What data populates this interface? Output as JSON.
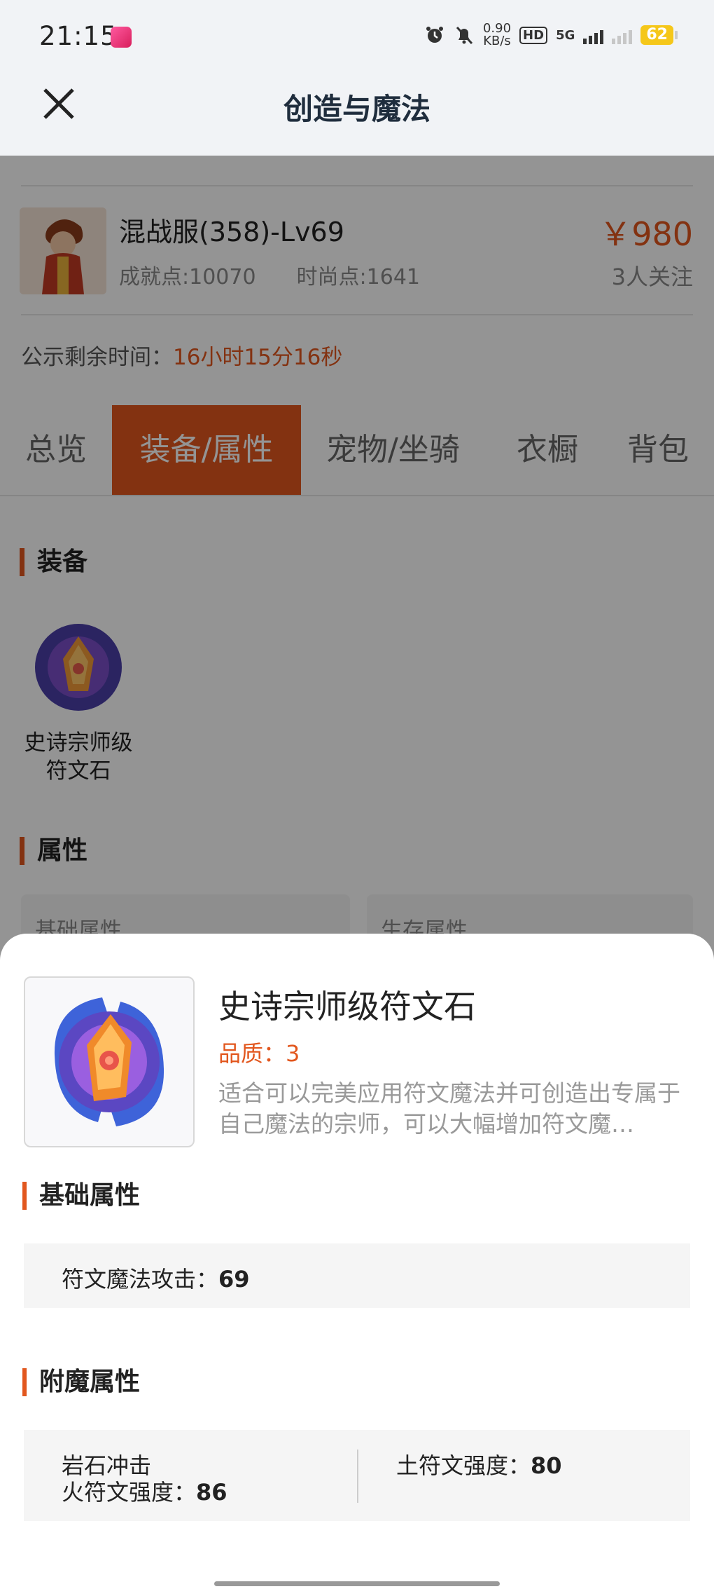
{
  "status_bar": {
    "time": "21:15",
    "net_speed_value": "0.90",
    "net_speed_unit": "KB/s",
    "hd_label": "HD",
    "network_label": "5G",
    "battery": "62"
  },
  "header": {
    "title": "创造与魔法"
  },
  "listing": {
    "name": "混战服(358)-Lv69",
    "achievement": "成就点:10070",
    "fashion": "时尚点:1641",
    "price": "￥980",
    "followers": "3人关注",
    "timer_label": "公示剩余时间：",
    "timer_value": "16小时15分16秒"
  },
  "tabs": [
    {
      "label": "总览"
    },
    {
      "label": "装备/属性",
      "active": true
    },
    {
      "label": "宠物/坐骑"
    },
    {
      "label": "衣橱"
    },
    {
      "label": "背包"
    }
  ],
  "equipment": {
    "heading": "装备",
    "item_line1": "史诗宗师级",
    "item_line2": "符文石"
  },
  "attributes": {
    "heading": "属性",
    "basic_box": "基础属性",
    "survival_box": "生存属性"
  },
  "sheet": {
    "title": "史诗宗师级符文石",
    "quality": "品质：3",
    "description": "适合可以完美应用符文魔法并可创造出专属于自己魔法的宗师，可以大幅增加符文魔…",
    "basic_heading": "基础属性",
    "basic_attr_label": "符文魔法攻击：",
    "basic_attr_value": "69",
    "enchant_heading": "附魔属性",
    "enchant_name": "岩石冲击",
    "enchant_attr1_label": "火符文强度：",
    "enchant_attr1_value": "86",
    "enchant_attr2_label": "土符文强度：",
    "enchant_attr2_value": "80"
  },
  "colors": {
    "accent": "#e2571e",
    "header_bg": "#f1f3f6",
    "panel_bg": "#f5f5f5"
  }
}
